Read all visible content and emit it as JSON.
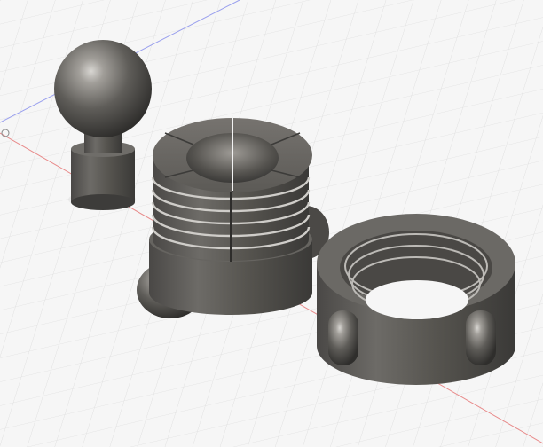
{
  "viewport": {
    "kind": "3d-cad-canvas",
    "background": "#f6f6f6",
    "grid_color": "#dcdcdc",
    "axis_colors": {
      "x": "#e88a8a",
      "y": "#9aa0ee"
    },
    "material_color": "#5e5c59"
  },
  "parts": [
    {
      "id": "ball-stud",
      "description_icon": "ball-stud-icon"
    },
    {
      "id": "split-collet",
      "description_icon": "collet-icon"
    },
    {
      "id": "threaded-cap-nut",
      "description_icon": "cap-nut-icon"
    }
  ]
}
